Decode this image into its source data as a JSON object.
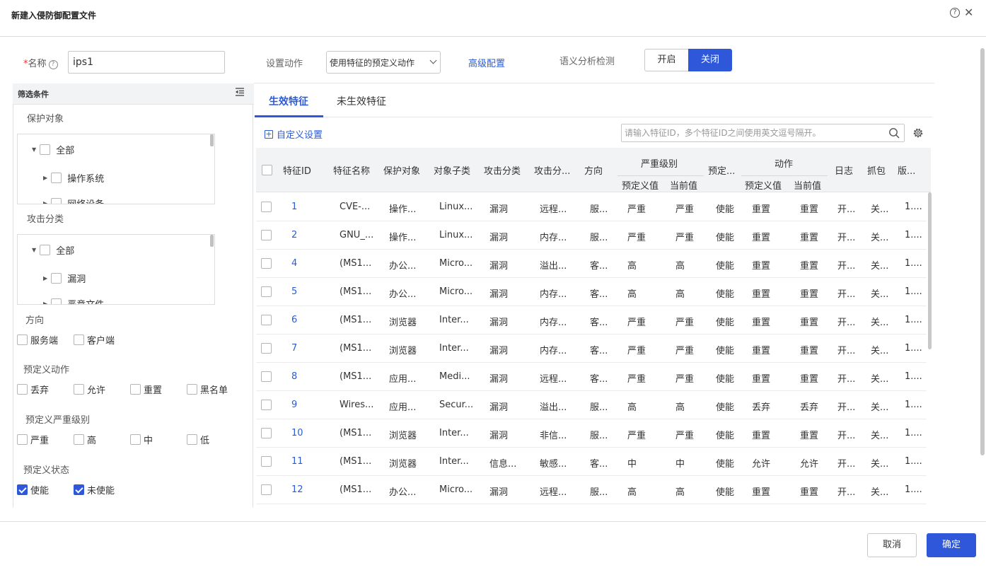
{
  "dialog": {
    "title": "新建入侵防御配置文件",
    "help": "?",
    "close": "✕"
  },
  "form": {
    "name_label": "名称",
    "name_required": "*",
    "name_help": "?",
    "name_value": "ips1",
    "action_label": "设置动作",
    "action_value": "使用特征的预定义动作",
    "advanced_link": "高级配置",
    "semantic_label": "语义分析检测",
    "toggle_on": "开启",
    "toggle_off": "关闭",
    "toggle_selected": "关闭"
  },
  "filter": {
    "title": "筛选条件",
    "protect": {
      "title": "保护对象",
      "root": "全部",
      "child": "操作系统",
      "child2": "网络设备"
    },
    "attack": {
      "title": "攻击分类",
      "root": "全部",
      "child": "漏洞",
      "child2": "恶意文件"
    },
    "direction": {
      "title": "方向",
      "options": [
        "服务端",
        "客户端"
      ]
    },
    "action": {
      "title": "预定义动作",
      "options": [
        "丢弃",
        "允许",
        "重置",
        "黑名单"
      ]
    },
    "severity": {
      "title": "预定义严重级别",
      "options": [
        "严重",
        "高",
        "中",
        "低"
      ]
    },
    "status": {
      "title": "预定义状态",
      "options": [
        "使能",
        "未使能"
      ],
      "checked": [
        true,
        true
      ]
    }
  },
  "tabs": [
    "生效特征",
    "未生效特征"
  ],
  "toolbar": {
    "custom": "自定义设置",
    "search_placeholder": "请输入特征ID，多个特征ID之间使用英文逗号隔开。"
  },
  "table": {
    "headers": {
      "id": "特征ID",
      "name": "特征名称",
      "protect": "保护对象",
      "subtype": "对象子类",
      "attack": "攻击分类",
      "attack_sub": "攻击分...",
      "direction": "方向",
      "severity": "严重级别",
      "sev_pre": "预定义值",
      "sev_cur": "当前值",
      "predef": "预定...",
      "action": "动作",
      "act_pre": "预定义值",
      "act_cur": "当前值",
      "log": "日志",
      "capture": "抓包",
      "version": "版..."
    },
    "rows": [
      [
        "1",
        "CVE-...",
        "操作...",
        "Linux...",
        "漏洞",
        "远程...",
        "服...",
        "严重",
        "严重",
        "使能",
        "重置",
        "重置",
        "开...",
        "关...",
        "1...."
      ],
      [
        "2",
        "GNU_...",
        "操作...",
        "Linux...",
        "漏洞",
        "内存...",
        "服...",
        "严重",
        "严重",
        "使能",
        "重置",
        "重置",
        "开...",
        "关...",
        "1...."
      ],
      [
        "4",
        "(MS1...",
        "办公...",
        "Micro...",
        "漏洞",
        "溢出...",
        "客...",
        "高",
        "高",
        "使能",
        "重置",
        "重置",
        "开...",
        "关...",
        "1...."
      ],
      [
        "5",
        "(MS1...",
        "办公...",
        "Micro...",
        "漏洞",
        "内存...",
        "客...",
        "高",
        "高",
        "使能",
        "重置",
        "重置",
        "开...",
        "关...",
        "1...."
      ],
      [
        "6",
        "(MS1...",
        "浏览器",
        "Inter...",
        "漏洞",
        "内存...",
        "客...",
        "严重",
        "严重",
        "使能",
        "重置",
        "重置",
        "开...",
        "关...",
        "1...."
      ],
      [
        "7",
        "(MS1...",
        "浏览器",
        "Inter...",
        "漏洞",
        "内存...",
        "客...",
        "严重",
        "严重",
        "使能",
        "重置",
        "重置",
        "开...",
        "关...",
        "1...."
      ],
      [
        "8",
        "(MS1...",
        "应用...",
        "Medi...",
        "漏洞",
        "远程...",
        "客...",
        "严重",
        "严重",
        "使能",
        "重置",
        "重置",
        "开...",
        "关...",
        "1...."
      ],
      [
        "9",
        "Wires...",
        "应用...",
        "Secur...",
        "漏洞",
        "溢出...",
        "服...",
        "高",
        "高",
        "使能",
        "丢弃",
        "丢弃",
        "开...",
        "关...",
        "1...."
      ],
      [
        "10",
        "(MS1...",
        "浏览器",
        "Inter...",
        "漏洞",
        "非信...",
        "服...",
        "严重",
        "严重",
        "使能",
        "重置",
        "重置",
        "开...",
        "关...",
        "1...."
      ],
      [
        "11",
        "(MS1...",
        "浏览器",
        "Inter...",
        "信息...",
        "敏感...",
        "客...",
        "中",
        "中",
        "使能",
        "允许",
        "允许",
        "开...",
        "关...",
        "1...."
      ],
      [
        "12",
        "(MS1...",
        "办公...",
        "Micro...",
        "漏洞",
        "远程...",
        "服...",
        "高",
        "高",
        "使能",
        "重置",
        "重置",
        "开...",
        "关...",
        "1...."
      ]
    ]
  },
  "footer": {
    "cancel": "取消",
    "ok": "确定"
  },
  "colors": {
    "accent": "#2f57d9",
    "link": "#2a5bd7"
  }
}
